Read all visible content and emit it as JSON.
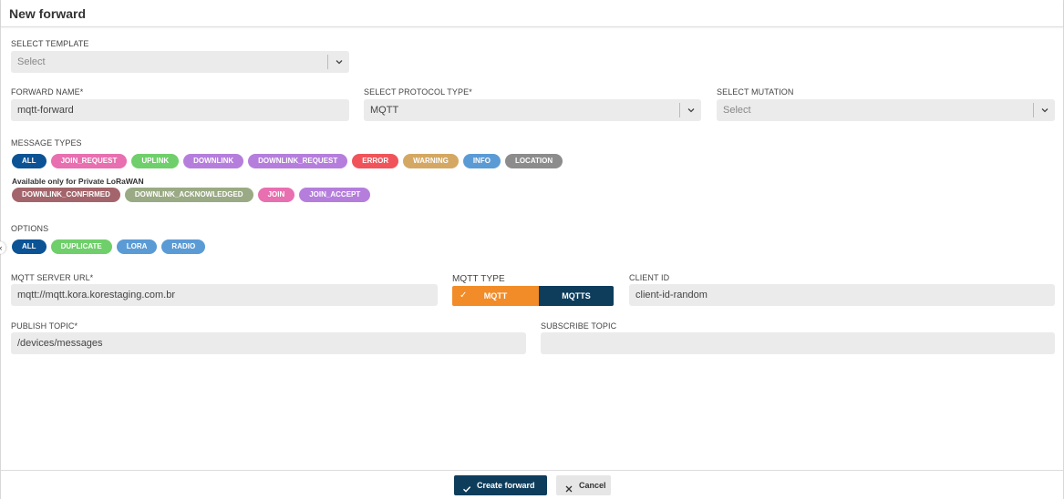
{
  "header": {
    "title": "New forward"
  },
  "template": {
    "label": "SELECT TEMPLATE",
    "placeholder": "Select"
  },
  "forward_name": {
    "label": "FORWARD NAME*",
    "value": "mqtt-forward"
  },
  "protocol": {
    "label": "SELECT PROTOCOL TYPE*",
    "value": "MQTT"
  },
  "mutation": {
    "label": "SELECT MUTATION",
    "placeholder": "Select"
  },
  "message_types": {
    "label": "MESSAGE TYPES",
    "chips": [
      {
        "label": "ALL",
        "color": "#0b5394"
      },
      {
        "label": "JOIN_REQUEST",
        "color": "#e86fb0"
      },
      {
        "label": "UPLINK",
        "color": "#6fcf6a"
      },
      {
        "label": "DOWNLINK",
        "color": "#b57edc"
      },
      {
        "label": "DOWNLINK_REQUEST",
        "color": "#b57edc"
      },
      {
        "label": "ERROR",
        "color": "#f0545a"
      },
      {
        "label": "WARNING",
        "color": "#d4a862"
      },
      {
        "label": "INFO",
        "color": "#5b9bd5"
      },
      {
        "label": "LOCATION",
        "color": "#8c8c8c"
      }
    ],
    "private_note": "Available only for Private LoRaWAN",
    "private_chips": [
      {
        "label": "DOWNLINK_CONFIRMED",
        "color": "#a3656b"
      },
      {
        "label": "DOWNLINK_ACKNOWLEDGED",
        "color": "#9aaa84"
      },
      {
        "label": "JOIN",
        "color": "#e86fb0"
      },
      {
        "label": "JOIN_ACCEPT",
        "color": "#b57edc"
      }
    ]
  },
  "options": {
    "label": "OPTIONS",
    "chips": [
      {
        "label": "ALL",
        "color": "#0b5394"
      },
      {
        "label": "DUPLICATE",
        "color": "#6fcf6a"
      },
      {
        "label": "LORA",
        "color": "#5b9bd5"
      },
      {
        "label": "RADIO",
        "color": "#5b9bd5"
      }
    ]
  },
  "mqtt_server": {
    "label": "MQTT SERVER URL*",
    "value": "mqtt://mqtt.kora.korestaging.com.br"
  },
  "mqtt_type": {
    "label": "MQTT TYPE",
    "options": [
      "MQTT",
      "MQTTS"
    ],
    "selected": "MQTT",
    "on_color": "#f28c28",
    "off_color": "#0e3d5c"
  },
  "client_id": {
    "label": "CLIENT ID",
    "value": "client-id-random"
  },
  "publish_topic": {
    "label": "PUBLISH TOPIC*",
    "value": "/devices/messages"
  },
  "subscribe_topic": {
    "label": "SUBSCRIBE TOPIC",
    "value": ""
  },
  "footer": {
    "create_label": "Create forward",
    "cancel_label": "Cancel"
  }
}
